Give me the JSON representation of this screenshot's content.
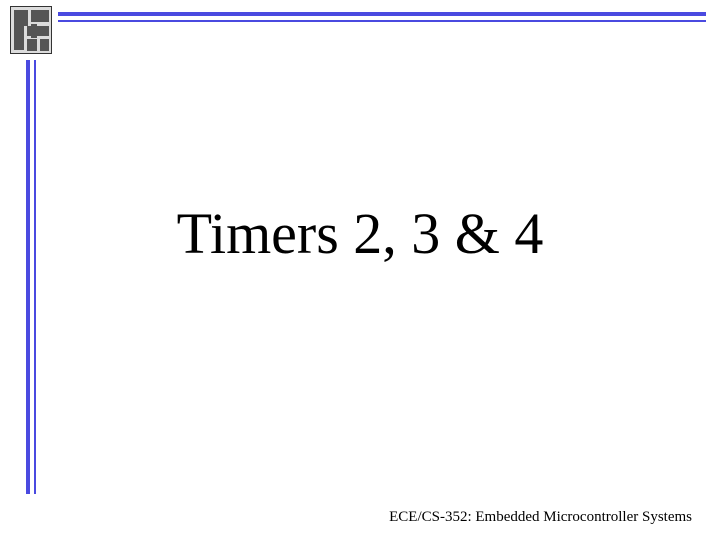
{
  "slide": {
    "title": "Timers 2, 3 & 4",
    "footer": "ECE/CS-352: Embedded Microcontroller Systems"
  },
  "theme": {
    "accent": "#4a4ae0"
  }
}
